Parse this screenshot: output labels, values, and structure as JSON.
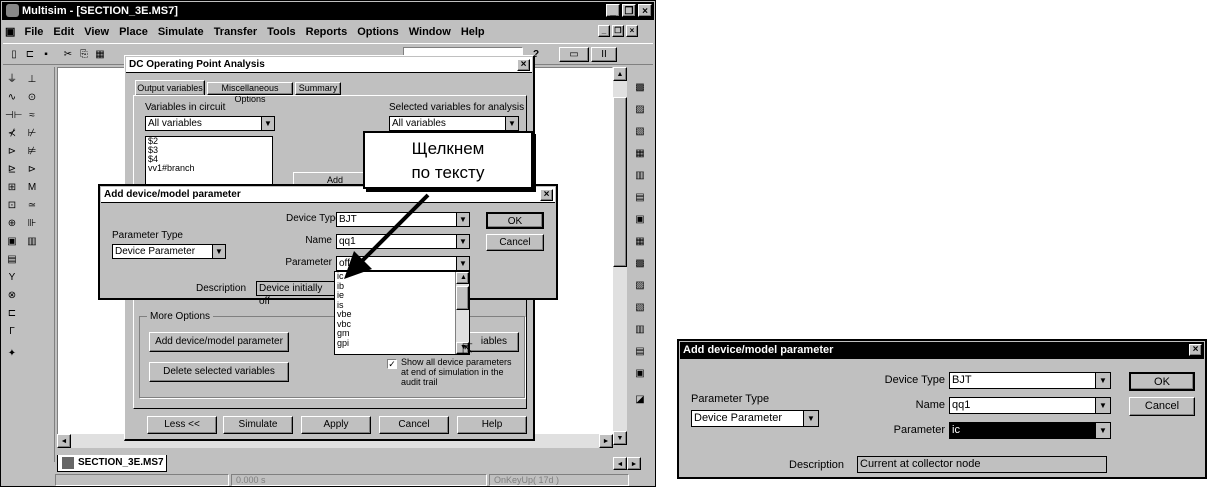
{
  "app": {
    "title": "Multisim - [SECTION_3E.MS7]",
    "menu": [
      "File",
      "Edit",
      "View",
      "Place",
      "Simulate",
      "Transfer",
      "Tools",
      "Reports",
      "Options",
      "Window",
      "Help"
    ],
    "doc_tab": "SECTION_3E.MS7",
    "status": [
      "0.000 s",
      "OnKeyUp( 17d )"
    ]
  },
  "dc_dialog": {
    "title": "DC Operating Point Analysis",
    "tabs": [
      "Output variables",
      "Miscellaneous Options",
      "Summary"
    ],
    "vars_label": "Variables in circuit",
    "vars_filter": "All variables",
    "vars_list": [
      "$2",
      "$3",
      "$4",
      "vv1#branch"
    ],
    "selected_label": "Selected variables for analysis",
    "selected_filter": "All variables",
    "add_button": "Add",
    "more_options_label": "More Options",
    "add_param_button": "Add device/model parameter",
    "delete_button": "Delete selected variables",
    "partial_button": "iables",
    "checkbox_label": "Show all device parameters at end of simulation in the audit trail",
    "less_button": "Less <<",
    "simulate_button": "Simulate",
    "apply_button": "Apply",
    "cancel_button": "Cancel",
    "help_button": "Help"
  },
  "add_param_dialog": {
    "title": "Add device/model parameter",
    "param_type_label": "Parameter Type",
    "param_type_value": "Device Parameter",
    "device_type_label": "Device Type",
    "device_type_value": "BJT",
    "name_label": "Name",
    "name_value": "qq1",
    "parameter_label": "Parameter",
    "parameter_value": "off",
    "description_label": "Description",
    "description_value": "Device initially off",
    "ok_button": "OK",
    "cancel_button": "Cancel",
    "param_options": [
      "ic",
      "ib",
      "ie",
      "is",
      "vbe",
      "vbc",
      "gm",
      "gpi"
    ]
  },
  "callout": {
    "text_line1": "Щелкнем",
    "text_line2": "по тексту"
  },
  "right_dialog": {
    "title": "Add device/model parameter",
    "param_type_label": "Parameter Type",
    "param_type_value": "Device Parameter",
    "device_type_label": "Device Type",
    "device_type_value": "BJT",
    "name_label": "Name",
    "name_value": "qq1",
    "parameter_label": "Parameter",
    "parameter_value": "ic",
    "description_label": "Description",
    "description_value": "Current at collector node",
    "ok_button": "OK",
    "cancel_button": "Cancel"
  }
}
